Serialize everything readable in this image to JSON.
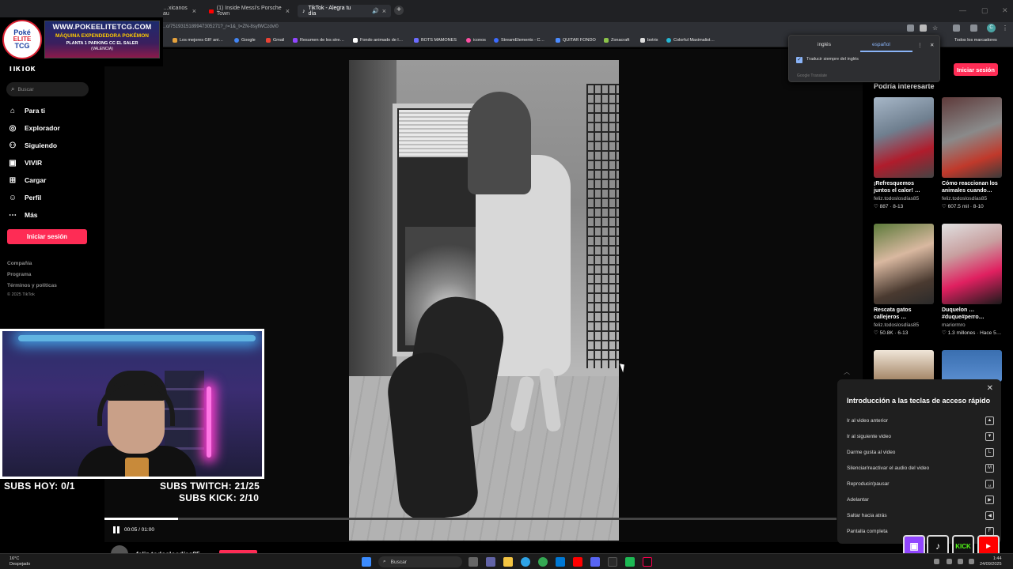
{
  "browser": {
    "tabs": [
      {
        "label": "…xicanos au"
      },
      {
        "label": "(1) Inside Messi's Porsche Town"
      },
      {
        "label": "TikTok - Alegra tu día",
        "active": true
      }
    ],
    "url": "…o/7519315189947305271?_r=1&_t=ZN-8syfWCzdvI0",
    "bookmarks": [
      "Los mejores GIF ani…",
      "Google",
      "Gmail",
      "Resumen de los stre…",
      "Fondo animado de l…",
      "BOTS MAMONES",
      "iconos",
      "StreamElements - C…",
      "QUITAR FONDO",
      "Zonacraft",
      "botrix",
      "Colorful Maximalist…"
    ],
    "all_bookmarks": "Todos los marcadores",
    "profile_initial": "C"
  },
  "overlay": {
    "logo_line1": "Poké",
    "logo_line2": "ELITE",
    "logo_line3": "TCG",
    "banner_url": "WWW.POKEELITETCG.COM",
    "banner_line2": "MÁQUINA EXPENDEDORA POKÉMON",
    "banner_line3": "PLANTA 1 PARKING CC EL SALER",
    "banner_line4": "(VALENCIA)",
    "subs_today": "SUBS HOY: 0/1",
    "subs_twitch": "SUBS TWITCH:  21/25",
    "subs_kick": "SUBS KICK:   2/10"
  },
  "tiktok": {
    "brand": "TikTok",
    "search_placeholder": "Buscar",
    "nav": [
      {
        "label": "Para ti",
        "icon": "home-icon"
      },
      {
        "label": "Explorador",
        "icon": "compass-icon"
      },
      {
        "label": "Siguiendo",
        "icon": "following-icon"
      },
      {
        "label": "VIVIR",
        "icon": "live-icon"
      },
      {
        "label": "Cargar",
        "icon": "upload-icon"
      },
      {
        "label": "Perfil",
        "icon": "profile-icon"
      },
      {
        "label": "Más",
        "icon": "more-icon"
      }
    ],
    "login": "Iniciar sesión",
    "footer": [
      "Compañía",
      "Programa",
      "Términos y políticas"
    ],
    "copyright": "© 2025 TikTok",
    "header_login": "Iniciar sesión",
    "recommendations_title": "Podría interesarte",
    "cards": [
      {
        "title": "¡Refresquemos\njuntos el calor! …",
        "user": "feliz.todoslosdías85",
        "stats": "♡ 887 · 8-13"
      },
      {
        "title": "Cómo reaccionan los\nanimales cuando…",
        "user": "feliz.todoslosdías85",
        "stats": "♡ 607.5 mil · 8-10"
      },
      {
        "title": "Rescata gatos\ncallejeros …",
        "user": "feliz.todoslosdías85",
        "stats": "♡ 50.8K · 6-13"
      },
      {
        "title": "Duquelon …\n#duque#perro…",
        "user": "mariormro",
        "stats": "♡ 1.3 millones · Hace 5…"
      }
    ],
    "player": {
      "time": "00:05 / 01:00",
      "progress": 0.1,
      "author": "feliz.todoslosdías85"
    }
  },
  "translate_popup": {
    "lang_source": "inglés",
    "lang_target": "español",
    "always_translate": "Traducir siempre del inglés",
    "provider": "Google Translate"
  },
  "shortcuts": {
    "title": "Introducción a las teclas de acceso rápido",
    "items": [
      {
        "label": "Ir al video anterior",
        "key": "▲"
      },
      {
        "label": "Ir al siguiente video",
        "key": "▼"
      },
      {
        "label": "Darme gusta al video",
        "key": "L"
      },
      {
        "label": "Silenciar/reactivar el audio del video",
        "key": "M"
      },
      {
        "label": "Reproducir/pausar",
        "key": "␣"
      },
      {
        "label": "Adelantar",
        "key": "▶"
      },
      {
        "label": "Saltar hacia atrás",
        "key": "◀"
      },
      {
        "label": "Pantalla completa",
        "key": "F"
      }
    ]
  },
  "taskbar": {
    "weather_temp": "16°C",
    "weather_desc": "Despejado",
    "search_placeholder": "Buscar",
    "time": "1:44",
    "date": "24/09/2025"
  },
  "colors": {
    "tiktok_red": "#fe2c55",
    "twitch": "#9146ff",
    "kick": "#53fc18",
    "youtube": "#ff0000"
  }
}
